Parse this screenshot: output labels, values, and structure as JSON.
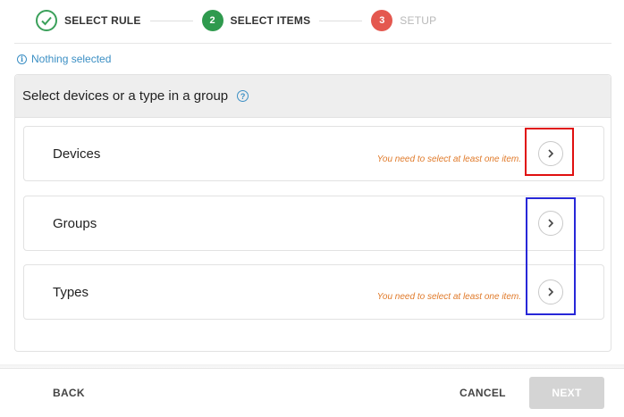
{
  "stepper": {
    "steps": [
      {
        "number": "",
        "label": "SELECT RULE",
        "state": "done"
      },
      {
        "number": "2",
        "label": "SELECT ITEMS",
        "state": "active"
      },
      {
        "number": "3",
        "label": "SETUP",
        "state": "pending"
      }
    ]
  },
  "info": {
    "text": "Nothing selected",
    "icon": "info-icon"
  },
  "panel": {
    "title": "Select devices or a type in a group",
    "help_icon_glyph": "?",
    "rows": [
      {
        "label": "Devices",
        "warning": "You need to select at least one item."
      },
      {
        "label": "Groups",
        "warning": ""
      },
      {
        "label": "Types",
        "warning": "You need to select at least one item."
      }
    ]
  },
  "footer": {
    "back_label": "BACK",
    "cancel_label": "CANCEL",
    "next_label": "NEXT"
  },
  "colors": {
    "done": "#3aa05a",
    "active": "#2f9a4e",
    "pending": "#e4584f",
    "link": "#3b8fc4",
    "warning": "#e07a2a",
    "annotation_red": "#e01010",
    "annotation_blue": "#2828d8"
  }
}
